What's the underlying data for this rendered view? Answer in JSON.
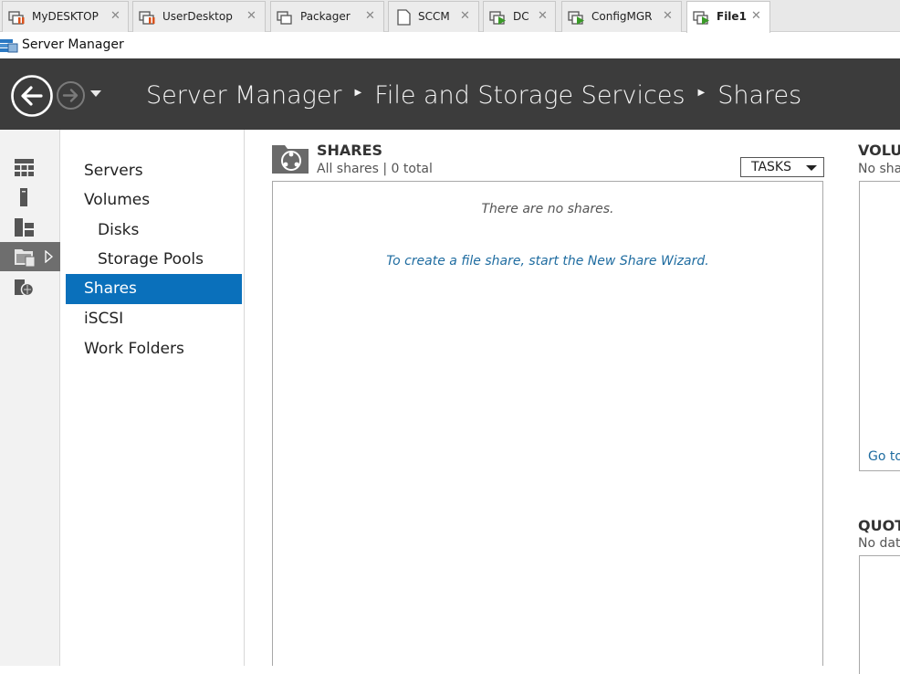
{
  "vm_tabs": [
    {
      "label": "MyDESKTOP",
      "icon": "vm-stopped-icon",
      "active": false
    },
    {
      "label": "UserDesktop",
      "icon": "vm-stopped-icon",
      "active": false
    },
    {
      "label": "Packager",
      "icon": "vm-icon",
      "active": false
    },
    {
      "label": "SCCM",
      "icon": "vm-off-icon",
      "active": false
    },
    {
      "label": "DC",
      "icon": "vm-running-icon",
      "active": false
    },
    {
      "label": "ConfigMGR",
      "icon": "vm-running-icon",
      "active": false
    },
    {
      "label": "File1",
      "icon": "vm-running-icon",
      "active": true
    }
  ],
  "window": {
    "title": "Server Manager"
  },
  "breadcrumb": [
    "Server Manager",
    "File and Storage Services",
    "Shares"
  ],
  "nav": {
    "items": [
      {
        "label": "Servers",
        "sub": false,
        "selected": false
      },
      {
        "label": "Volumes",
        "sub": false,
        "selected": false
      },
      {
        "label": "Disks",
        "sub": true,
        "selected": false
      },
      {
        "label": "Storage Pools",
        "sub": true,
        "selected": false
      },
      {
        "label": "Shares",
        "sub": false,
        "selected": true
      },
      {
        "label": "iSCSI",
        "sub": false,
        "selected": false
      },
      {
        "label": "Work Folders",
        "sub": false,
        "selected": false
      }
    ]
  },
  "shares": {
    "title": "SHARES",
    "subtitle": "All shares | 0 total",
    "tasks_label": "TASKS",
    "empty_message": "There are no shares.",
    "wizard_link": "To create a file share, start the New Share Wizard."
  },
  "volume": {
    "title": "VOLU",
    "subtitle": "No sha",
    "link": "Go to"
  },
  "quota": {
    "title": "QUOT",
    "subtitle": "No dat"
  },
  "colors": {
    "header_bg": "#3c3c3c",
    "selected": "#0a70bb",
    "link": "#1f6ca0"
  }
}
